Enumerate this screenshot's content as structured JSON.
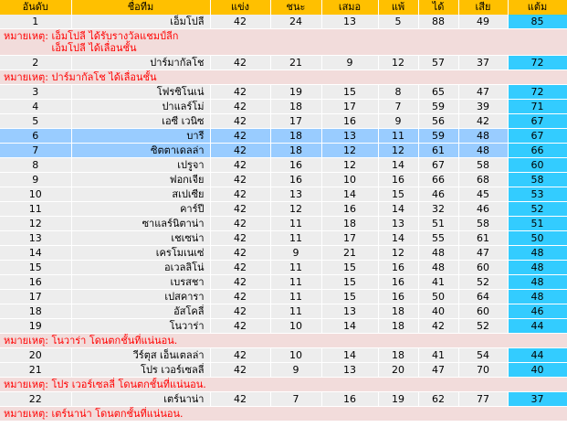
{
  "headers": [
    "อันดับ",
    "ชื่อทีม",
    "แข่ง",
    "ชนะ",
    "เสมอ",
    "แพ้",
    "ได้",
    "เสีย",
    "แต้ม"
  ],
  "note_label": "หมายเหตุ:",
  "colors": {
    "header": "#FFC000",
    "row": "#EDEDED",
    "highlight": "#99CCFF",
    "points_cyan": "#33CCFF",
    "note_bg": "#F2DCDB",
    "note_text": "#FF0000"
  },
  "rows": [
    {
      "type": "team",
      "pos": "1",
      "name": "เอ็มโปลี",
      "p": "42",
      "w": "24",
      "d": "13",
      "l": "5",
      "gf": "88",
      "ga": "49",
      "pts": "85",
      "hl": false,
      "cyan": true
    },
    {
      "type": "note",
      "lines": [
        "เอ็มโปลี ได้รับรางวัลแชมป์ลีก",
        "เอ็มโปลี ได้เลื่อนชั้น"
      ]
    },
    {
      "type": "team",
      "pos": "2",
      "name": "ปาร์มากัลโช",
      "p": "42",
      "w": "21",
      "d": "9",
      "l": "12",
      "gf": "57",
      "ga": "37",
      "pts": "72",
      "hl": false,
      "cyan": true
    },
    {
      "type": "note",
      "lines": [
        "ปาร์มากัลโช ได้เลื่อนชั้น"
      ]
    },
    {
      "type": "team",
      "pos": "3",
      "name": "โฟรซิโนเน่",
      "p": "42",
      "w": "19",
      "d": "15",
      "l": "8",
      "gf": "65",
      "ga": "47",
      "pts": "72",
      "hl": false,
      "cyan": true
    },
    {
      "type": "team",
      "pos": "4",
      "name": "ปาแลร์โม่",
      "p": "42",
      "w": "18",
      "d": "17",
      "l": "7",
      "gf": "59",
      "ga": "39",
      "pts": "71",
      "hl": false,
      "cyan": true
    },
    {
      "type": "team",
      "pos": "5",
      "name": "เอซี เวนิซ",
      "p": "42",
      "w": "17",
      "d": "16",
      "l": "9",
      "gf": "56",
      "ga": "42",
      "pts": "67",
      "hl": false,
      "cyan": true
    },
    {
      "type": "team",
      "pos": "6",
      "name": "บารี",
      "p": "42",
      "w": "18",
      "d": "13",
      "l": "11",
      "gf": "59",
      "ga": "48",
      "pts": "67",
      "hl": true,
      "cyan": true
    },
    {
      "type": "team",
      "pos": "7",
      "name": "ซิตตาเดลล่า",
      "p": "42",
      "w": "18",
      "d": "12",
      "l": "12",
      "gf": "61",
      "ga": "48",
      "pts": "66",
      "hl": true,
      "cyan": true
    },
    {
      "type": "team",
      "pos": "8",
      "name": "เปรูจา",
      "p": "42",
      "w": "16",
      "d": "12",
      "l": "14",
      "gf": "67",
      "ga": "58",
      "pts": "60",
      "hl": false,
      "cyan": true
    },
    {
      "type": "team",
      "pos": "9",
      "name": "ฟอกเจีย",
      "p": "42",
      "w": "16",
      "d": "10",
      "l": "16",
      "gf": "66",
      "ga": "68",
      "pts": "58",
      "hl": false,
      "cyan": true
    },
    {
      "type": "team",
      "pos": "10",
      "name": "สเปเซีย",
      "p": "42",
      "w": "13",
      "d": "14",
      "l": "15",
      "gf": "46",
      "ga": "45",
      "pts": "53",
      "hl": false,
      "cyan": true
    },
    {
      "type": "team",
      "pos": "11",
      "name": "คาร์ปี",
      "p": "42",
      "w": "12",
      "d": "16",
      "l": "14",
      "gf": "32",
      "ga": "46",
      "pts": "52",
      "hl": false,
      "cyan": true
    },
    {
      "type": "team",
      "pos": "12",
      "name": "ซาแลร์นิตาน่า",
      "p": "42",
      "w": "11",
      "d": "18",
      "l": "13",
      "gf": "51",
      "ga": "58",
      "pts": "51",
      "hl": false,
      "cyan": true
    },
    {
      "type": "team",
      "pos": "13",
      "name": "เชเซน่า",
      "p": "42",
      "w": "11",
      "d": "17",
      "l": "14",
      "gf": "55",
      "ga": "61",
      "pts": "50",
      "hl": false,
      "cyan": true
    },
    {
      "type": "team",
      "pos": "14",
      "name": "เครโมเนเซ่",
      "p": "42",
      "w": "9",
      "d": "21",
      "l": "12",
      "gf": "48",
      "ga": "47",
      "pts": "48",
      "hl": false,
      "cyan": true
    },
    {
      "type": "team",
      "pos": "15",
      "name": "อเวลลิโน่",
      "p": "42",
      "w": "11",
      "d": "15",
      "l": "16",
      "gf": "48",
      "ga": "60",
      "pts": "48",
      "hl": false,
      "cyan": true
    },
    {
      "type": "team",
      "pos": "16",
      "name": "เบรสชา",
      "p": "42",
      "w": "11",
      "d": "15",
      "l": "16",
      "gf": "41",
      "ga": "52",
      "pts": "48",
      "hl": false,
      "cyan": true
    },
    {
      "type": "team",
      "pos": "17",
      "name": "เปสคารา",
      "p": "42",
      "w": "11",
      "d": "15",
      "l": "16",
      "gf": "50",
      "ga": "64",
      "pts": "48",
      "hl": false,
      "cyan": true
    },
    {
      "type": "team",
      "pos": "18",
      "name": "อัสโคลี่",
      "p": "42",
      "w": "11",
      "d": "13",
      "l": "18",
      "gf": "40",
      "ga": "60",
      "pts": "46",
      "hl": false,
      "cyan": true
    },
    {
      "type": "team",
      "pos": "19",
      "name": "โนวาร่า",
      "p": "42",
      "w": "10",
      "d": "14",
      "l": "18",
      "gf": "42",
      "ga": "52",
      "pts": "44",
      "hl": false,
      "cyan": true
    },
    {
      "type": "note",
      "lines": [
        "โนวาร่า โดนตกชั้นที่แน่นอน."
      ]
    },
    {
      "type": "team",
      "pos": "20",
      "name": "วีร์ตุส เอ็นเตลล่า",
      "p": "42",
      "w": "10",
      "d": "14",
      "l": "18",
      "gf": "41",
      "ga": "54",
      "pts": "44",
      "hl": false,
      "cyan": true
    },
    {
      "type": "team",
      "pos": "21",
      "name": "โปร เวอร์เซลลี่",
      "p": "42",
      "w": "9",
      "d": "13",
      "l": "20",
      "gf": "47",
      "ga": "70",
      "pts": "40",
      "hl": false,
      "cyan": true
    },
    {
      "type": "note",
      "lines": [
        "โปร เวอร์เซลลี่ โดนตกชั้นที่แน่นอน."
      ]
    },
    {
      "type": "team",
      "pos": "22",
      "name": "เตร์นาน่า",
      "p": "42",
      "w": "7",
      "d": "16",
      "l": "19",
      "gf": "62",
      "ga": "77",
      "pts": "37",
      "hl": false,
      "cyan": true
    },
    {
      "type": "note",
      "lines": [
        "เตร์นาน่า โดนตกชั้นที่แน่นอน."
      ]
    }
  ]
}
